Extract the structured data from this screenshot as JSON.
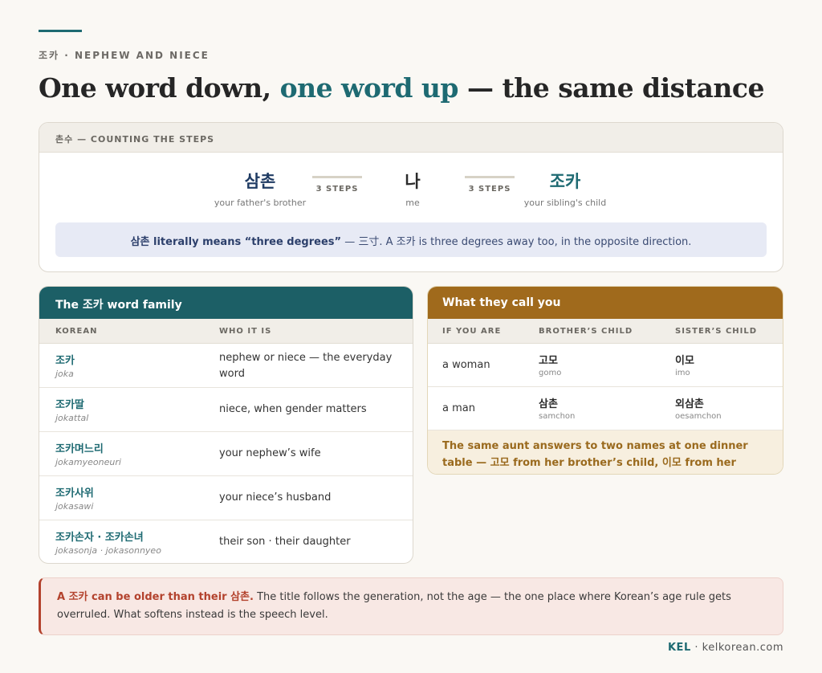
{
  "header": {
    "eyebrow": "조카 · NEPHEW AND NIECE",
    "headline_part1": "One word down, ",
    "headline_accent": "one word up",
    "headline_part2": " — the same distance"
  },
  "counting": {
    "label": "촌수 — COUNTING THE STEPS",
    "left": {
      "word": "삼촌",
      "gloss": "your father's brother"
    },
    "step_left": "3 STEPS",
    "center": {
      "word": "나",
      "gloss": "me"
    },
    "step_right": "3 STEPS",
    "right": {
      "word": "조카",
      "gloss": "your sibling's child"
    },
    "note_bold": "삼촌 literally means “three degrees”",
    "note_rest": " — 三寸. A 조카 is three degrees away too, in the opposite direction."
  },
  "word_family": {
    "title": "The 조카 word family",
    "col_korean": "KOREAN",
    "col_who": "WHO IT IS",
    "rows": [
      {
        "korean": "조카",
        "roman": "joka",
        "meaning": "nephew or niece — the everyday word"
      },
      {
        "korean": "조카딸",
        "roman": "jokattal",
        "meaning": "niece, when gender matters"
      },
      {
        "korean": "조카며느리",
        "roman": "jokamyeoneuri",
        "meaning": "your nephew’s wife"
      },
      {
        "korean": "조카사위",
        "roman": "jokasawi",
        "meaning": "your niece’s husband"
      },
      {
        "korean": "조카손자 · 조카손녀",
        "roman": "jokasonja · jokasonnyeo",
        "meaning": "their son · their daughter"
      }
    ]
  },
  "call_you": {
    "title": "What they call you",
    "col_if": "IF YOU ARE",
    "col_brother": "BROTHER’S CHILD",
    "col_sister": "SISTER’S CHILD",
    "rows": [
      {
        "who": "a woman",
        "brother": "고모",
        "brother_rom": "gomo",
        "sister": "이모",
        "sister_rom": "imo"
      },
      {
        "who": "a man",
        "brother": "삼촌",
        "brother_rom": "samchon",
        "sister": "외삼촌",
        "sister_rom": "oesamchon"
      }
    ],
    "note": "The same aunt answers to two names at one dinner table — 고모 from her brother’s child, 이모 from her sister’s."
  },
  "warning": {
    "bold": "A 조카 can be older than their 삼촌.",
    "rest": " The title follows the generation, not the age — the one place where Korean’s age rule gets overruled. What softens instead is the speech level."
  },
  "footer": {
    "brand": "KEL",
    "sep": " · ",
    "site": "kelkorean.com"
  },
  "colors": {
    "teal": "#1e6a72",
    "navy": "#1f3b63",
    "amber": "#a06a1c",
    "red": "#b3422d"
  }
}
